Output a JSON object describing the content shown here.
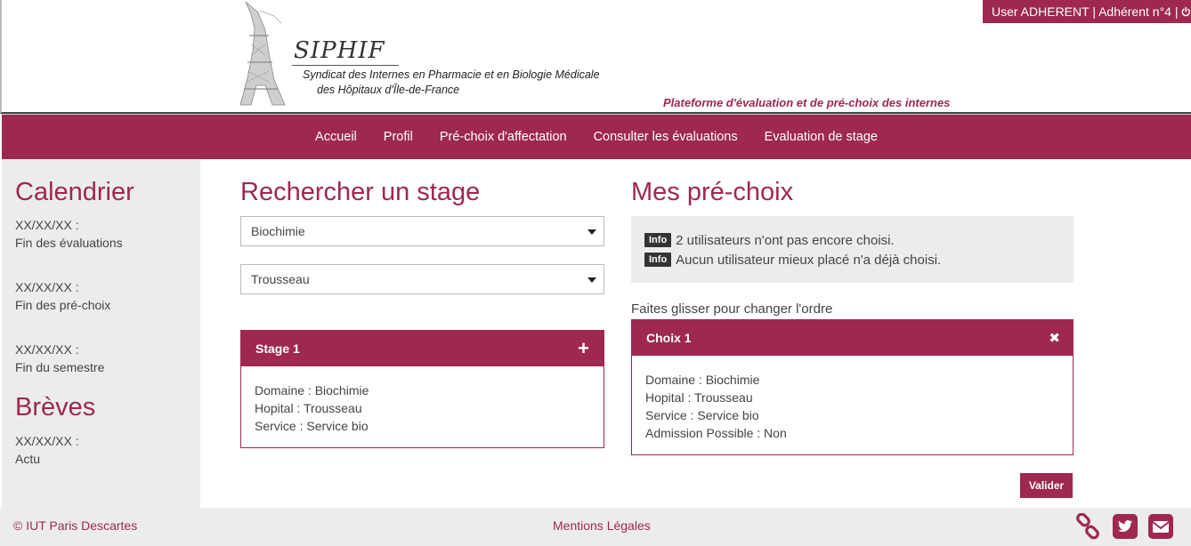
{
  "header": {
    "brand": "SIPHIF",
    "subtitle_line1": "Syndicat des Internes en Pharmacie et en Biologie Médicale",
    "subtitle_line2": "des Hôpitaux d'Île-de-France",
    "tagline": "Plateforme d'évaluation et de pré-choix des internes",
    "user_label": "User ADHERENT | Adhérent n°4 |",
    "power_icon": "power-icon"
  },
  "nav": {
    "items": [
      {
        "label": "Accueil"
      },
      {
        "label": "Profil"
      },
      {
        "label": "Pré-choix d'affectation"
      },
      {
        "label": "Consulter les évaluations"
      },
      {
        "label": "Evaluation de stage"
      }
    ]
  },
  "sidebar": {
    "calendar_title": "Calendrier",
    "events": [
      {
        "date": "XX/XX/XX :",
        "label": "Fin des évaluations"
      },
      {
        "date": "XX/XX/XX :",
        "label": "Fin des pré-choix"
      },
      {
        "date": "XX/XX/XX :",
        "label": "Fin du semestre"
      }
    ],
    "news_title": "Brèves",
    "news": [
      {
        "date": "XX/XX/XX :",
        "label": "Actu"
      }
    ]
  },
  "search": {
    "title": "Rechercher un stage",
    "domain_value": "Biochimie",
    "hospital_value": "Trousseau",
    "result": {
      "title": "Stage 1",
      "lines": [
        "Domaine : Biochimie",
        "Hopital : Trousseau",
        "Service : Service bio"
      ]
    }
  },
  "prechoix": {
    "title": "Mes pré-choix",
    "badge_label": "Info",
    "infos": [
      "2 utilisateurs n'ont pas encore choisi.",
      "Aucun utilisateur mieux placé n'a déjà choisi."
    ],
    "hint": "Faites glisser pour changer l'ordre",
    "choice": {
      "title": "Choix 1",
      "lines": [
        "Domaine : Biochimie",
        "Hopital : Trousseau",
        "Service : Service bio",
        "Admission Possible : Non"
      ]
    },
    "validate_label": "Valider"
  },
  "footer": {
    "copyright": "© IUT Paris Descartes",
    "legal": "Mentions Légales",
    "icons": [
      "link-icon",
      "twitter-icon",
      "mail-icon"
    ]
  },
  "colors": {
    "accent": "#9e2850",
    "panel": "#ececec"
  }
}
